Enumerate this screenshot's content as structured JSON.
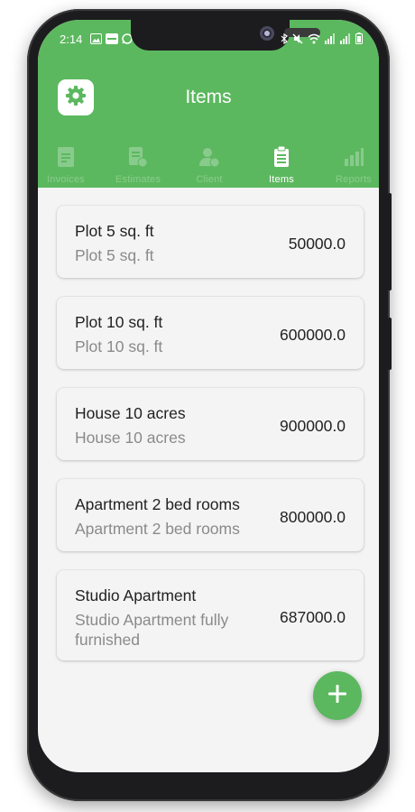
{
  "status_bar": {
    "time": "2:14",
    "left_icons": [
      "image-icon",
      "app-badge-icon",
      "whatsapp-icon"
    ],
    "right_icons": [
      "bluetooth-icon",
      "mute-icon",
      "wifi-icon",
      "signal-icon",
      "signal-icon",
      "battery-icon"
    ]
  },
  "header": {
    "title": "Items",
    "settings_icon": "gear-icon"
  },
  "tabs": [
    {
      "label": "Invoices",
      "icon": "invoice-icon",
      "active": false
    },
    {
      "label": "Estimates",
      "icon": "estimate-icon",
      "active": false
    },
    {
      "label": "Client",
      "icon": "client-icon",
      "active": false
    },
    {
      "label": "Items",
      "icon": "clipboard-icon",
      "active": true
    },
    {
      "label": "Reports",
      "icon": "chart-icon",
      "active": false
    }
  ],
  "items": [
    {
      "name": "Plot 5 sq. ft",
      "description": "Plot 5 sq. ft",
      "price": "50000.0"
    },
    {
      "name": "Plot 10 sq. ft",
      "description": "Plot 10 sq. ft",
      "price": "600000.0"
    },
    {
      "name": "House 10 acres",
      "description": "House 10 acres",
      "price": "900000.0"
    },
    {
      "name": "Apartment 2 bed rooms",
      "description": "Apartment 2 bed rooms",
      "price": "800000.0"
    },
    {
      "name": "Studio Apartment",
      "description": "Studio Apartment fully furnished",
      "price": "687000.0"
    }
  ],
  "fab": {
    "icon": "plus-icon"
  },
  "colors": {
    "accent": "#5cb85f",
    "background": "#f4f4f4",
    "primary_text": "#222222",
    "secondary_text": "#8a8a8a"
  }
}
